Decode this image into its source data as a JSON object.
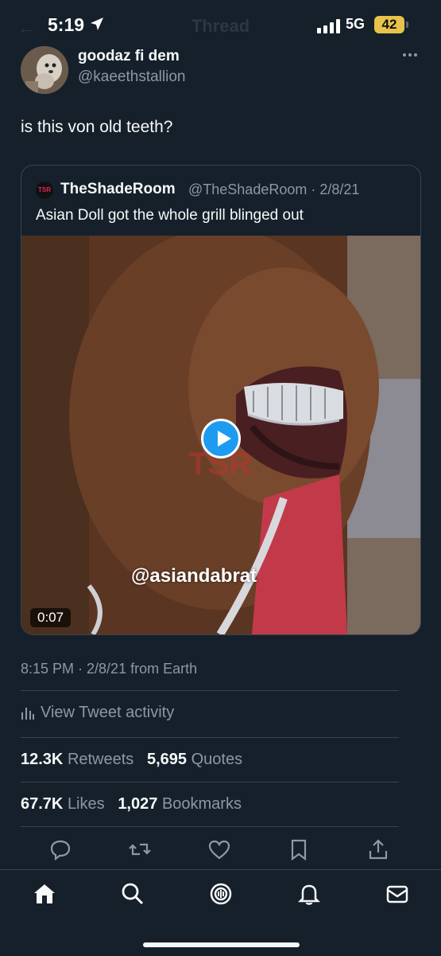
{
  "status_bar": {
    "time": "5:19",
    "network": "5G",
    "battery": "42",
    "title": "Thread"
  },
  "tweet": {
    "author_name": "goodaz fi dem",
    "author_handle": "@kaeethstallion",
    "text": "is this von old teeth?",
    "meta": "8:15 PM · 2/8/21 from Earth",
    "activity_label": "View Tweet activity",
    "retweets": {
      "count": "12.3K",
      "label": "Retweets"
    },
    "quotes": {
      "count": "5,695",
      "label": "Quotes"
    },
    "likes": {
      "count": "67.7K",
      "label": "Likes"
    },
    "bookmarks": {
      "count": "1,027",
      "label": "Bookmarks"
    }
  },
  "quoted_tweet": {
    "name": "TheShadeRoom",
    "handle_date": "@TheShadeRoom · 2/8/21",
    "text": "Asian Doll got the whole grill blinged out",
    "video_tag": "@asiandabrat",
    "duration": "0:07",
    "logo_text": "TSR"
  },
  "actions": [
    "reply-icon",
    "retweet-icon",
    "like-icon",
    "bookmark-icon",
    "share-icon"
  ],
  "tabs": [
    "home-icon",
    "search-icon",
    "spaces-icon",
    "notifications-icon",
    "messages-icon"
  ],
  "colors": {
    "background": "#15202b",
    "accent": "#1d9bf0",
    "secondary_text": "#8b98a5",
    "border": "#38444d"
  }
}
